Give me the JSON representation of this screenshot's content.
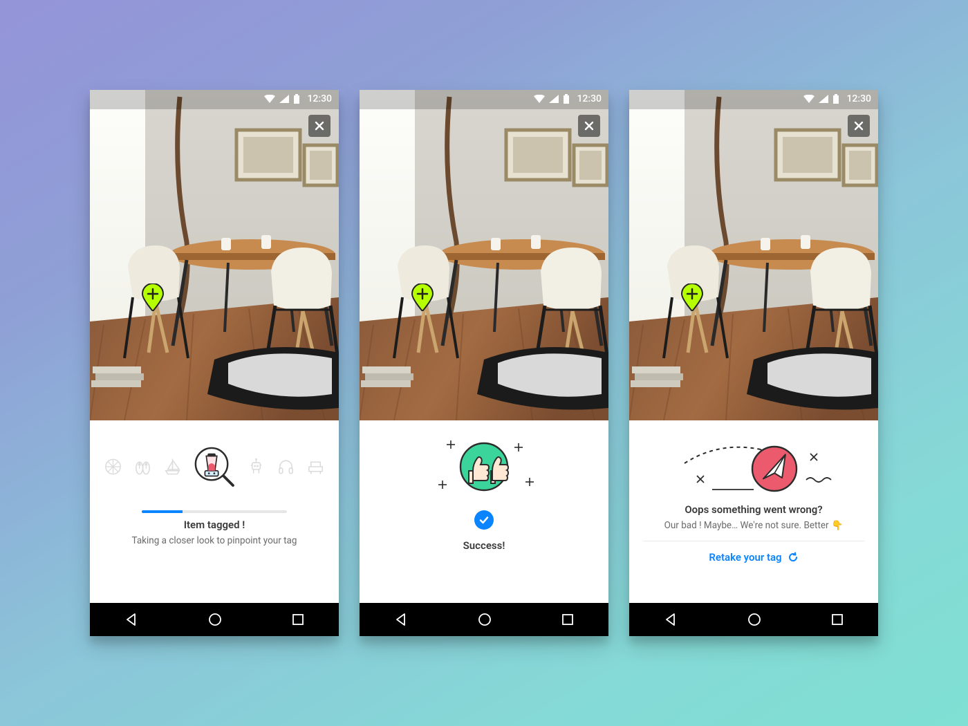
{
  "statusbar": {
    "time": "12:30"
  },
  "colors": {
    "accent": "#0a84ff",
    "success": "#3bd49a",
    "error": "#ec5a6e",
    "tag": "#b6ff00"
  },
  "screens": {
    "loading": {
      "title": "Item tagged !",
      "subtitle": "Taking a closer look to pinpoint your tag",
      "progress_percent": 28,
      "category_icons": [
        "basketball-icon",
        "sandals-icon",
        "sailboat-icon",
        "blender-icon",
        "robot-icon",
        "headphones-icon",
        "armchair-icon"
      ]
    },
    "success": {
      "title": "Success!"
    },
    "error": {
      "title": "Oops something went wrong?",
      "subtitle": "Our bad ! Maybe… We're not sure. Better",
      "subtitle_emoji": "👇",
      "retake_label": "Retake your tag"
    }
  }
}
